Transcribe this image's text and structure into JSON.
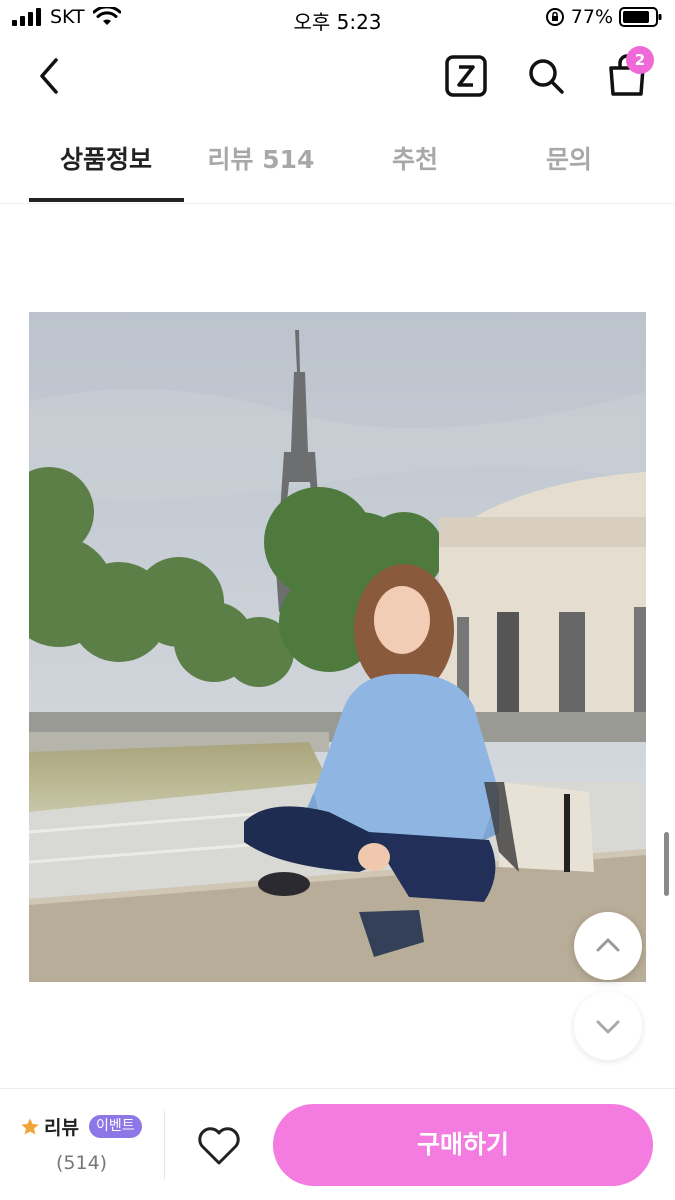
{
  "status_bar": {
    "carrier": "SKT",
    "time": "오후 5:23",
    "battery": "77%"
  },
  "header": {
    "back_icon": "chevron-left-icon",
    "z_icon": "z-logo-icon",
    "search_icon": "search-icon",
    "cart_icon": "shopping-bag-icon",
    "cart_count": "2"
  },
  "tabs": [
    {
      "label": "상품정보",
      "active": true
    },
    {
      "label": "리뷰 514",
      "active": false
    },
    {
      "label": "추천",
      "active": false
    },
    {
      "label": "문의",
      "active": false
    }
  ],
  "bottom_bar": {
    "review_label": "리뷰",
    "event_badge": "이벤트",
    "review_count": "(514)",
    "buy_label": "구매하기"
  },
  "colors": {
    "accent_pink": "#f47be0",
    "badge_purple": "#8d76e6",
    "star": "#f2a33a"
  }
}
